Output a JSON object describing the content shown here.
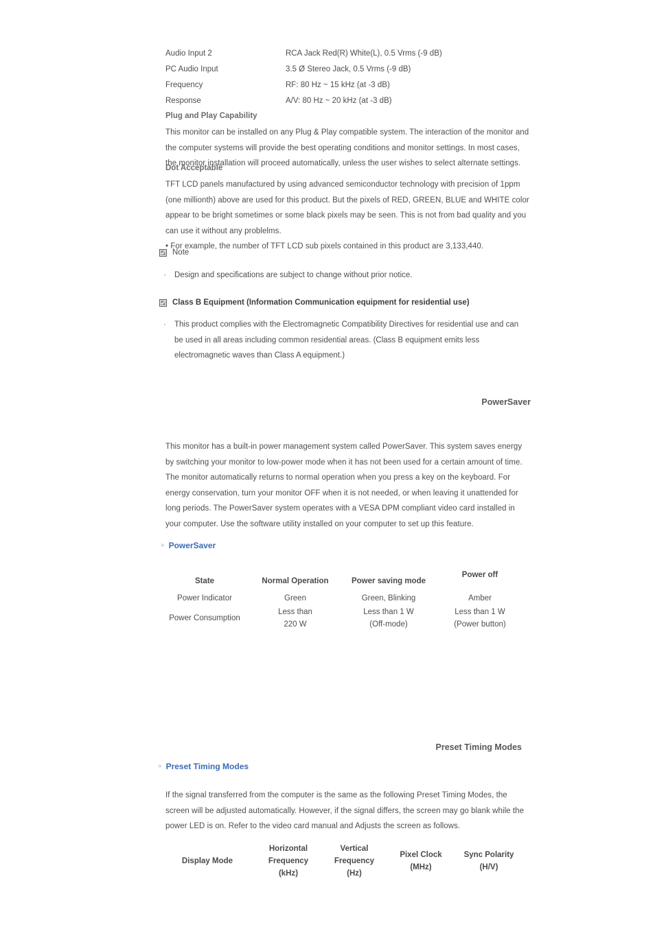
{
  "spec_rows": [
    {
      "label": "Audio Input 2",
      "value": "RCA Jack Red(R) White(L), 0.5 Vrms (-9 dB)"
    },
    {
      "label": "PC Audio Input",
      "value": "3.5 Ø Stereo Jack, 0.5 Vrms (-9 dB)"
    },
    {
      "label": "Frequency",
      "value": "RF: 80 Hz ~ 15 kHz (at -3 dB)"
    },
    {
      "label": "Response",
      "value": "A/V: 80 Hz ~ 20 kHz (at -3 dB)"
    }
  ],
  "plug_and_play": {
    "heading": "Plug and Play Capability",
    "paragraph": "This monitor can be installed on any Plug & Play compatible system. The interaction of the monitor and the computer systems will provide the best operating conditions and monitor settings. In most cases, the monitor installation will proceed automatically, unless the user wishes to select alternate settings."
  },
  "dot_acceptable": {
    "heading": "Dot Acceptable",
    "paragraph": "TFT LCD panels manufactured by using advanced semiconductor technology with precision of 1ppm (one millionth) above are used for this product. But the pixels of RED, GREEN, BLUE and WHITE color appear to be bright sometimes or some black pixels may be seen. This is not from bad quality and you can use it without any problelms.",
    "example_line": "• For example, the number of TFT LCD sub pixels contained in this product are 3,133,440."
  },
  "note": {
    "icon": "checkbox-icon",
    "label": "Note",
    "bullet_marker": "·",
    "items": [
      "Design and specifications are subject to change without prior notice."
    ]
  },
  "class_b": {
    "icon": "checkbox-icon",
    "label": "Class B Equipment (Information Communication equipment for residential use)",
    "bullet_marker": "·",
    "items": [
      "This product complies with the Electromagnetic Compatibility Directives for residential use and can be used in all areas including common residential areas. (Class B equipment emits less electromagnetic waves than Class A equipment.)"
    ]
  },
  "powersaver": {
    "section_title": "PowerSaver",
    "paragraph": "This monitor has a built-in power management system called PowerSaver. This system saves energy by switching your monitor to low-power mode when it has not been used for a certain amount of time. The monitor automatically returns to normal operation when you press a key on the keyboard. For energy conservation, turn your monitor OFF when it is not needed, or when leaving it unattended for long periods. The PowerSaver system operates with a VESA DPM compliant video card installed in your computer. Use the software utility installed on your computer to set up this feature.",
    "anchor_label": "PowerSaver",
    "anchor_marker": "»",
    "anchor_color": "#3a6cb5",
    "table": {
      "headers": [
        "State",
        "Normal Operation",
        "Power saving mode",
        "Power off"
      ],
      "rows": [
        {
          "label": "Power Indicator",
          "cells": [
            {
              "line1": "Green",
              "line2": ""
            },
            {
              "line1": "Green, Blinking",
              "line2": ""
            },
            {
              "line1": "Amber",
              "line2": ""
            }
          ]
        },
        {
          "label": "Power Consumption",
          "cells": [
            {
              "line1": "Less than",
              "line2": "220 W"
            },
            {
              "line1": "Less than 1 W",
              "line2": "(Off-mode)"
            },
            {
              "line1": "Less than 1 W",
              "line2": "(Power button)"
            }
          ]
        }
      ]
    }
  },
  "preset_timing": {
    "section_title": "Preset Timing Modes",
    "anchor_label": "Preset Timing Modes",
    "anchor_marker": "»",
    "paragraph": "If the signal transferred from the computer is the same as the following Preset Timing Modes, the screen will be adjusted automatically. However, if the signal differs, the screen may go blank while the power LED is on. Refer to the video card manual and Adjusts the screen as follows.",
    "table_headers": [
      {
        "line1": "Display Mode",
        "line2": "",
        "line3": ""
      },
      {
        "line1": "Horizontal",
        "line2": "Frequency",
        "line3": "(kHz)"
      },
      {
        "line1": "Vertical",
        "line2": "Frequency",
        "line3": "(Hz)"
      },
      {
        "line1": "Pixel Clock",
        "line2": "(MHz)",
        "line3": ""
      },
      {
        "line1": "Sync Polarity",
        "line2": "(H/V)",
        "line3": ""
      }
    ]
  }
}
